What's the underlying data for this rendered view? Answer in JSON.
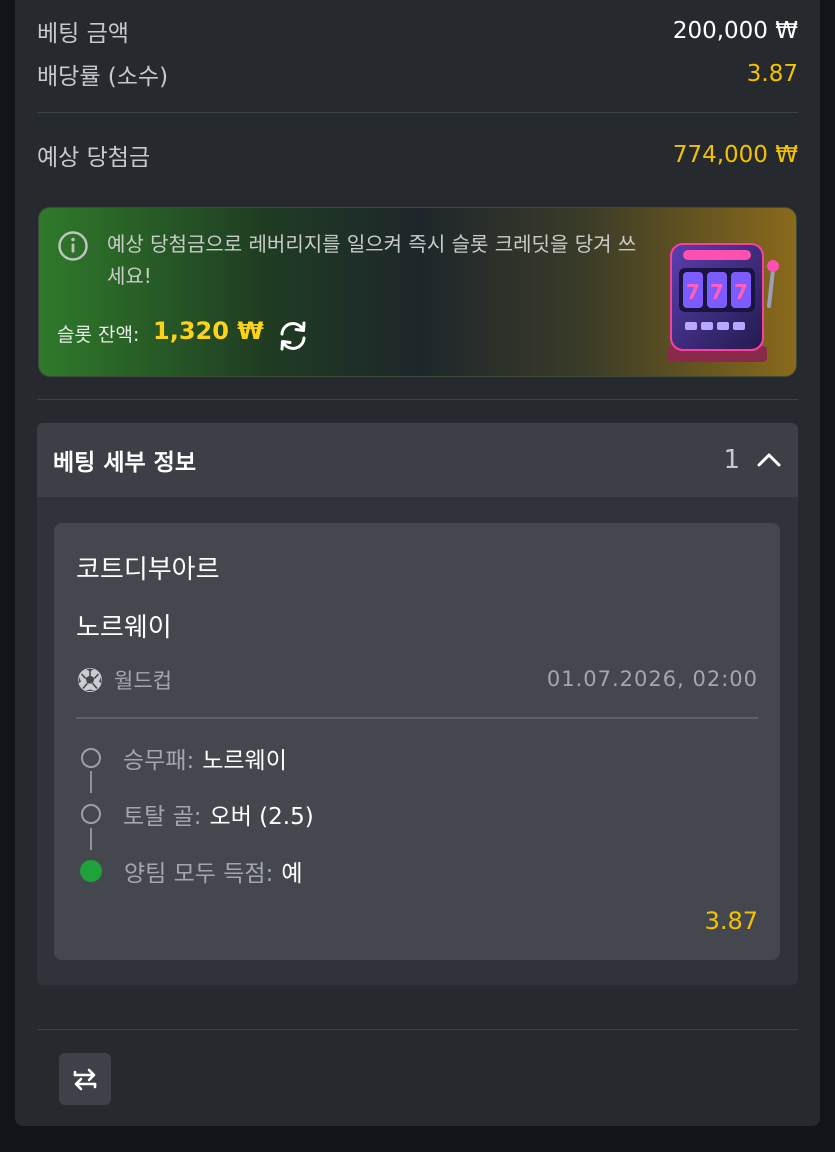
{
  "summary": {
    "bet_amount_label": "베팅 금액",
    "bet_amount_value": "200,000 ₩",
    "odds_label": "배당률 (소수)",
    "odds_value": "3.87",
    "potential_win_label": "예상 당첨금",
    "potential_win_value": "774,000 ₩"
  },
  "promo": {
    "message": "예상 당첨금으로 레버리지를 일으켜 즉시 슬롯 크레딧을 당겨 쓰세요!",
    "balance_label": "슬롯 잔액:",
    "balance_value": "1,320 ₩",
    "slot_reels": "777"
  },
  "details": {
    "title": "베팅 세부 정보",
    "count": "1",
    "card": {
      "team_home": "코트디부아르",
      "team_away": "노르웨이",
      "league": "월드컵",
      "datetime": "01.07.2026, 02:00",
      "selections": [
        {
          "market": "승무패:",
          "pick": "노르웨이",
          "status": "pending"
        },
        {
          "market": "토탈 골:",
          "pick": "오버 (2.5)",
          "status": "pending"
        },
        {
          "market": "양팀 모두 득점:",
          "pick": "예",
          "status": "won"
        }
      ],
      "odds": "3.87"
    }
  },
  "colors": {
    "accent_gold": "#f2c200",
    "won_green": "#1ea33a",
    "panel_bg": "#262a2f"
  }
}
